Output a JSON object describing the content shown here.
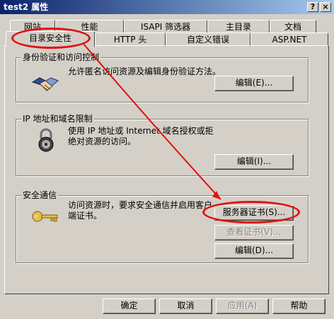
{
  "window": {
    "title": "test2 属性",
    "help_label": "?",
    "close_label": "×"
  },
  "tabs": {
    "row_back": [
      "网站",
      "性能",
      "ISAPI 筛选器",
      "主目录",
      "文档"
    ],
    "row_front": [
      "目录安全性",
      "HTTP 头",
      "自定义错误",
      "ASP.NET"
    ]
  },
  "groups": {
    "auth": {
      "title": "身份验证和访问控制",
      "desc": "允许匿名访问资源及编辑身份验证方法。",
      "icon": "handshake-icon",
      "edit_label": "编辑(E)..."
    },
    "ip": {
      "title": "IP 地址和域名限制",
      "desc": "使用 IP 地址或 Internet 域名授权或拒绝对资源的访问。",
      "icon": "lock-icon",
      "edit_label": "编辑(I)..."
    },
    "secure": {
      "title": "安全通信",
      "desc": "访问资源时，要求安全通信并启用客户端证书。",
      "icon": "key-icon",
      "server_cert_label": "服务器证书(S)...",
      "view_cert_label": "查看证书(V)...",
      "edit_label": "编辑(D)..."
    }
  },
  "footer": {
    "ok": "确定",
    "cancel": "取消",
    "apply": "应用(A)",
    "help": "帮助"
  },
  "annotation": {
    "color": "#e01010"
  }
}
